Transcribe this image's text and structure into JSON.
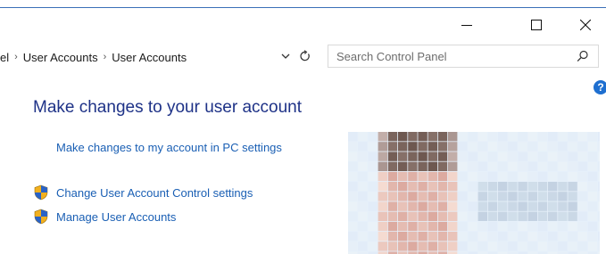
{
  "window": {
    "minimize_icon": "minimize-icon",
    "maximize_icon": "maximize-icon",
    "close_icon": "close-icon"
  },
  "address_bar": {
    "breadcrumb": [
      "el",
      "User Accounts",
      "User Accounts"
    ],
    "separator_icon": "chevron-right-icon",
    "dropdown_icon": "chevron-down-icon",
    "refresh_icon": "refresh-icon"
  },
  "search": {
    "placeholder": "Search Control Panel",
    "icon": "search-icon"
  },
  "help": {
    "label": "?"
  },
  "main": {
    "title": "Make changes to your user account",
    "pc_settings_link": "Make changes to my account in PC settings",
    "tasks": [
      {
        "icon": "uac-shield-icon",
        "label": "Change User Account Control settings"
      },
      {
        "icon": "uac-shield-icon",
        "label": "Manage User Accounts"
      }
    ]
  },
  "account_picture": {
    "icon": "user-avatar-pixelated"
  },
  "colors": {
    "window_accent": "#3a6fb8",
    "title_text": "#1e3287",
    "link_text": "#1a5fb4",
    "help_blue": "#1e6fd0",
    "avatar_background": "#e6f0fa"
  }
}
